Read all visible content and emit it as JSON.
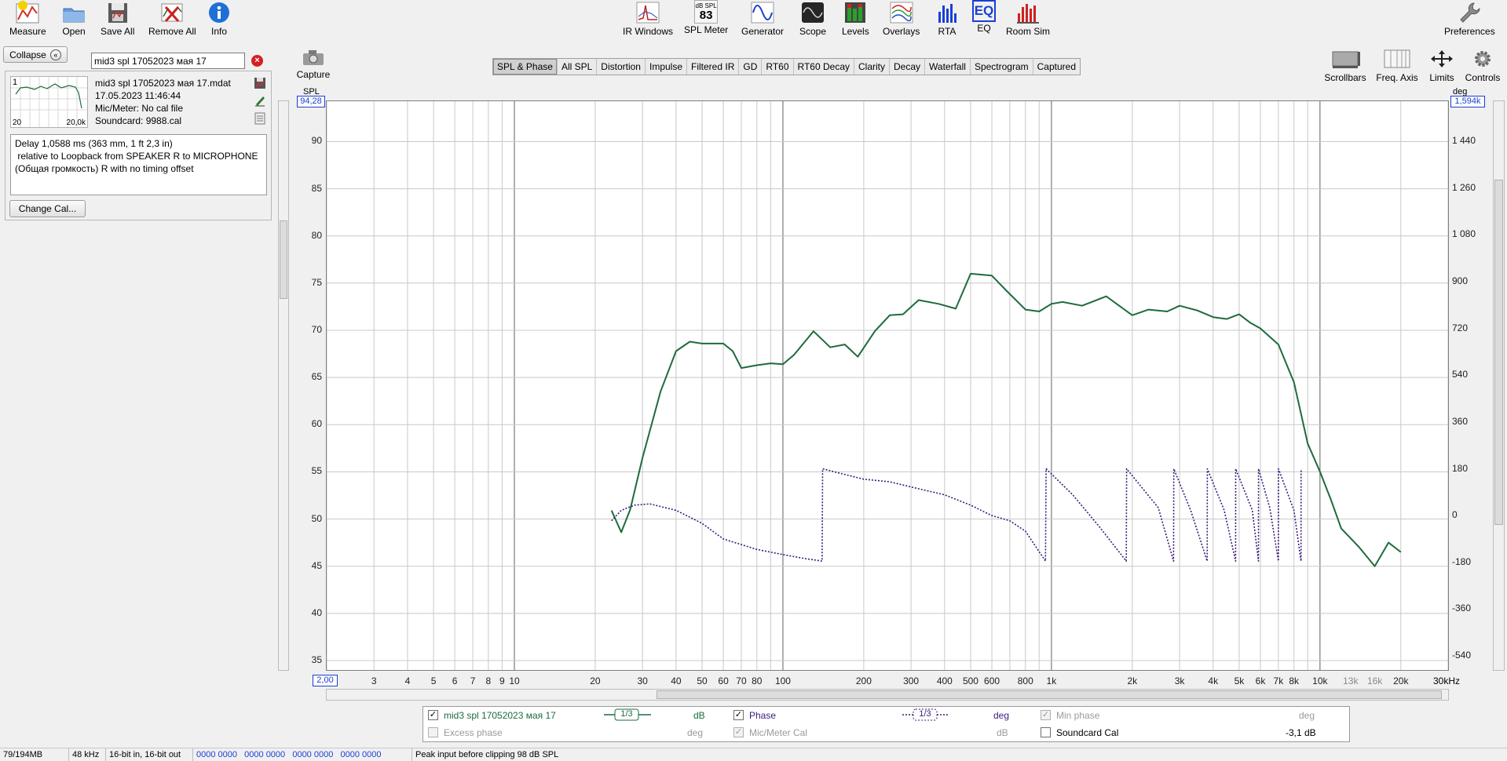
{
  "toolbar": {
    "measure": "Measure",
    "open": "Open",
    "save_all": "Save All",
    "remove_all": "Remove All",
    "info": "Info",
    "ir_windows": "IR Windows",
    "spl_meter": "SPL Meter",
    "spl_meter_badge_top": "dB SPL",
    "spl_meter_badge_value": "83",
    "generator": "Generator",
    "scope": "Scope",
    "levels": "Levels",
    "overlays": "Overlays",
    "rta": "RTA",
    "eq": "EQ",
    "eq_glyph": "EQ",
    "room_sim": "Room Sim",
    "preferences": "Preferences"
  },
  "left_panel": {
    "collapse_label": "Collapse",
    "measurement_name": "mid3 spl 17052023 мая 17",
    "thumb_index": "1",
    "thumb_x_min": "20",
    "thumb_x_max": "20,0k",
    "file_name": "mid3 spl 17052023 мая 17.mdat",
    "date": "17.05.2023 11:46:44",
    "mic_meter": "Mic/Meter: No cal file",
    "soundcard": "Soundcard: 9988.cal",
    "notes": "Delay 1,0588 ms (363 mm, 1 ft 2,3 in)\n relative to Loopback from SPEAKER R to MICROPHONE (Общая громкость) R with no timing offset",
    "change_cal": "Change Cal..."
  },
  "capture": {
    "label": "Capture"
  },
  "tabs": [
    "SPL & Phase",
    "All SPL",
    "Distortion",
    "Impulse",
    "Filtered IR",
    "GD",
    "RT60",
    "RT60 Decay",
    "Clarity",
    "Decay",
    "Waterfall",
    "Spectrogram",
    "Captured"
  ],
  "active_tab": "SPL & Phase",
  "right_tools": {
    "scrollbars": "Scrollbars",
    "freq_axis": "Freq. Axis",
    "limits": "Limits",
    "controls": "Controls"
  },
  "axes": {
    "left_unit": "SPL",
    "right_unit": "deg",
    "left_top_value": "94,28",
    "right_top_value": "1,594k",
    "x_start_value": "2,00",
    "x_end_label": "30kHz"
  },
  "legend": {
    "row1": [
      {
        "checked": true,
        "name": "mid3 spl 17052023 мая 17",
        "smoothing": "1/3",
        "unit": "dB",
        "color": "#1e6b3c"
      },
      {
        "checked": true,
        "name": "Phase",
        "smoothing": "1/3",
        "unit": "deg",
        "color": "#3a1a7a"
      },
      {
        "checked": true,
        "disabled": true,
        "name": "Min phase",
        "unit": "deg"
      }
    ],
    "row2": [
      {
        "checked": false,
        "disabled": true,
        "name": "Excess phase",
        "unit": "deg"
      },
      {
        "checked": true,
        "disabled": true,
        "name": "Mic/Meter Cal",
        "unit": "dB"
      },
      {
        "checked": false,
        "name": "Soundcard Cal",
        "value": "-3,1 dB"
      }
    ]
  },
  "status": {
    "memory": "79/194MB",
    "rate": "48 kHz",
    "bits": "16-bit in, 16-bit out",
    "levels": "0000 0000   0000 0000   0000 0000   0000 0000",
    "peak": "Peak input before clipping 98 dB SPL"
  },
  "colors": {
    "spl_trace": "#1e6b3c",
    "phase_trace": "#3a1a7a",
    "accent": "#1a3fd6"
  },
  "chart_data": {
    "type": "line",
    "title": "",
    "xlabel": "",
    "ylabel": "SPL",
    "y2label": "deg",
    "x_scale": "log",
    "xlim": [
      2,
      30000
    ],
    "ylim": [
      34,
      94.28
    ],
    "y2lim": [
      -594,
      1594
    ],
    "grid": true,
    "x_ticks": [
      {
        "v": 3,
        "l": "3"
      },
      {
        "v": 4,
        "l": "4"
      },
      {
        "v": 5,
        "l": "5"
      },
      {
        "v": 6,
        "l": "6"
      },
      {
        "v": 7,
        "l": "7"
      },
      {
        "v": 8,
        "l": "8"
      },
      {
        "v": 9,
        "l": "9"
      },
      {
        "v": 10,
        "l": "10"
      },
      {
        "v": 20,
        "l": "20"
      },
      {
        "v": 30,
        "l": "30"
      },
      {
        "v": 40,
        "l": "40"
      },
      {
        "v": 50,
        "l": "50"
      },
      {
        "v": 60,
        "l": "60"
      },
      {
        "v": 70,
        "l": "70"
      },
      {
        "v": 80,
        "l": "80"
      },
      {
        "v": 100,
        "l": "100"
      },
      {
        "v": 200,
        "l": "200"
      },
      {
        "v": 300,
        "l": "300"
      },
      {
        "v": 400,
        "l": "400"
      },
      {
        "v": 500,
        "l": "500"
      },
      {
        "v": 600,
        "l": "600"
      },
      {
        "v": 800,
        "l": "800"
      },
      {
        "v": 1000,
        "l": "1k"
      },
      {
        "v": 2000,
        "l": "2k"
      },
      {
        "v": 3000,
        "l": "3k"
      },
      {
        "v": 4000,
        "l": "4k"
      },
      {
        "v": 5000,
        "l": "5k"
      },
      {
        "v": 6000,
        "l": "6k"
      },
      {
        "v": 7000,
        "l": "7k"
      },
      {
        "v": 8000,
        "l": "8k"
      },
      {
        "v": 10000,
        "l": "10k"
      },
      {
        "v": 13000,
        "l": "13k"
      },
      {
        "v": 16000,
        "l": "16k"
      },
      {
        "v": 20000,
        "l": "20k"
      }
    ],
    "y_ticks": [
      "90",
      "85",
      "80",
      "75",
      "70",
      "65",
      "60",
      "55",
      "50",
      "45",
      "40",
      "35"
    ],
    "y2_ticks": [
      "1 440",
      "1 260",
      "1 080",
      "900",
      "720",
      "540",
      "360",
      "180",
      "0",
      "-180",
      "-360",
      "-540"
    ],
    "series": [
      {
        "name": "mid3 spl 17052023 мая 17",
        "axis": "left",
        "x": [
          23,
          25,
          27,
          30,
          35,
          40,
          45,
          50,
          60,
          65,
          70,
          80,
          90,
          100,
          110,
          130,
          150,
          170,
          190,
          220,
          250,
          280,
          320,
          380,
          440,
          500,
          600,
          680,
          800,
          900,
          1000,
          1100,
          1300,
          1600,
          2000,
          2300,
          2700,
          3000,
          3500,
          4000,
          4500,
          5000,
          5500,
          6000,
          7000,
          8000,
          9000,
          10000,
          11000,
          12000,
          14000,
          16000,
          18000,
          20000
        ],
        "y": [
          50.9,
          48.6,
          51.0,
          56.5,
          63.5,
          67.8,
          68.8,
          68.6,
          68.6,
          67.8,
          66.0,
          66.3,
          66.5,
          66.4,
          67.4,
          69.9,
          68.2,
          68.5,
          67.2,
          69.9,
          71.6,
          71.7,
          73.2,
          72.8,
          72.3,
          76.0,
          75.8,
          74.2,
          72.2,
          72.0,
          72.8,
          73.0,
          72.6,
          73.6,
          71.6,
          72.2,
          72.0,
          72.6,
          72.1,
          71.4,
          71.2,
          71.7,
          70.8,
          70.2,
          68.5,
          64.5,
          58.0,
          55.0,
          52.0,
          49.0,
          47.0,
          45.0,
          47.5,
          46.5
        ],
        "color": "#1e6b3c"
      },
      {
        "name": "Phase",
        "axis": "right",
        "x": [
          23,
          25,
          28,
          32,
          40,
          50,
          60,
          80,
          100,
          120,
          140,
          140.5,
          160,
          200,
          250,
          300,
          400,
          500,
          600,
          700,
          800,
          950,
          955,
          1200,
          1500,
          1900,
          1905,
          2500,
          2850,
          2855,
          3300,
          3800,
          3805,
          4400,
          4850,
          4855,
          5600,
          5900,
          5905,
          6500,
          7000,
          7005,
          8000,
          8500,
          8505
        ],
        "y": [
          -20,
          20,
          40,
          45,
          20,
          -30,
          -90,
          -130,
          -150,
          -165,
          -175,
          180,
          165,
          140,
          130,
          110,
          80,
          40,
          0,
          -20,
          -60,
          -175,
          180,
          80,
          -40,
          -175,
          180,
          30,
          -175,
          180,
          20,
          -175,
          180,
          20,
          -175,
          180,
          20,
          -175,
          180,
          30,
          -175,
          180,
          20,
          -175,
          180
        ],
        "color": "#3a1a7a"
      }
    ]
  }
}
